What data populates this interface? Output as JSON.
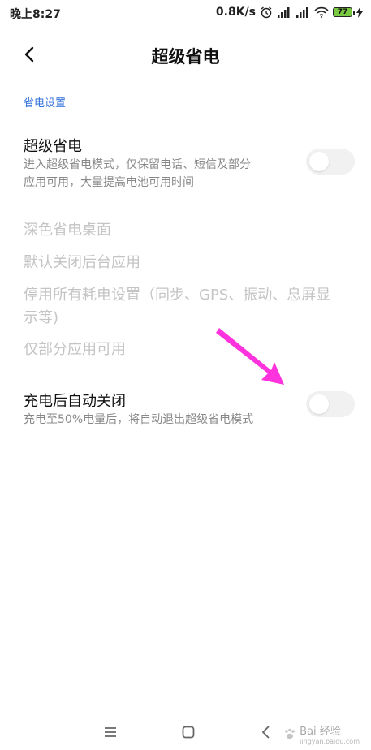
{
  "status_bar": {
    "time": "晚上8:27",
    "net_speed": "0.8K/s",
    "battery": "77"
  },
  "header": {
    "title": "超级省电"
  },
  "section": {
    "label": "省电设置"
  },
  "super_saver": {
    "title": "超级省电",
    "desc_line1": "进入超级省电模式，仅保留电话、短信及部分",
    "desc_line2": "应用可用，大量提高电池可用时间",
    "enabled": false
  },
  "disabled_items": [
    {
      "label": "深色省电桌面"
    },
    {
      "label": "默认关闭后台应用"
    },
    {
      "label": "停用所有耗电设置（同步、GPS、振动、息屏显"
    },
    {
      "label": "示等)"
    },
    {
      "label": "仅部分应用可用"
    }
  ],
  "auto_close": {
    "title": "充电后自动关闭",
    "desc": "充电至50%电量后，将自动退出超级省电模式",
    "enabled": false
  },
  "arrow_color": "#ff33dd",
  "accent_color": "#2f6fdb",
  "watermark": {
    "text": "Bai 经验",
    "sub": "jingyan.baidu.com"
  }
}
